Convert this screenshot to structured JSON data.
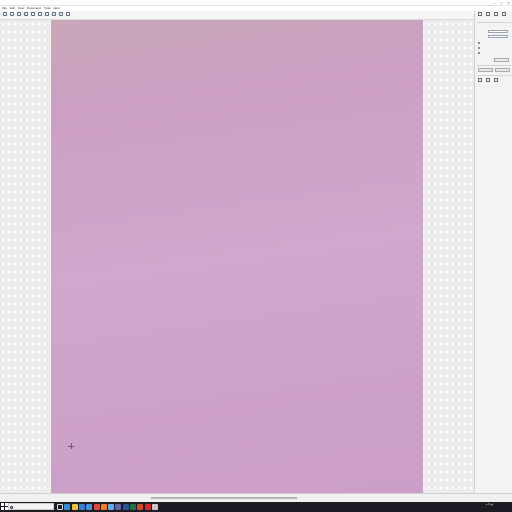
{
  "window": {
    "title": "",
    "controls": [
      "—",
      "□",
      "✕"
    ]
  },
  "menu": [
    "File",
    "Edit",
    "View",
    "Document",
    "Tools",
    "Help"
  ],
  "toolbar": [
    {
      "label": "",
      "icon": "open-icon"
    },
    {
      "label": "",
      "icon": "save-icon"
    },
    {
      "label": "",
      "icon": "print-icon"
    },
    {
      "label": "",
      "icon": "text-icon"
    },
    {
      "label": "",
      "icon": "edit-icon"
    },
    {
      "label": "",
      "icon": "image-icon"
    },
    {
      "label": "",
      "icon": "zoom-in-icon"
    },
    {
      "label": "",
      "icon": "zoom-out-icon"
    },
    {
      "label": "",
      "icon": "page-icon"
    },
    {
      "label": "",
      "icon": "settings-icon"
    },
    {
      "label": "",
      "icon": "help-icon"
    }
  ],
  "panel": {
    "tools": [
      {
        "label": "",
        "icon": "select-icon"
      },
      {
        "label": "",
        "icon": "draw-icon"
      },
      {
        "label": "",
        "icon": "crop-icon"
      },
      {
        "label": "",
        "icon": "fill-icon"
      }
    ],
    "fields": [
      {
        "label": "",
        "value": ""
      },
      {
        "label": "",
        "value": ""
      }
    ],
    "options": [
      {
        "label": ""
      },
      {
        "label": ""
      },
      {
        "label": ""
      },
      {
        "label": ""
      }
    ],
    "apply_label": "",
    "lower_buttons": [
      "",
      ""
    ],
    "bottom_tools": [
      {
        "label": "",
        "icon": "page-icon"
      },
      {
        "label": "",
        "icon": "copy-icon"
      },
      {
        "label": "",
        "icon": "layers-icon"
      }
    ]
  },
  "status": {
    "left": "",
    "mid1": "",
    "mid2": "",
    "right": ""
  },
  "taskbar": {
    "search_placeholder": "",
    "apps": [
      {
        "name": "task-view",
        "color": "#ffffff"
      },
      {
        "name": "edge",
        "color": "#2f8fd8"
      },
      {
        "name": "file-explorer",
        "color": "#f0c23a"
      },
      {
        "name": "store",
        "color": "#3a7bd5"
      },
      {
        "name": "mail",
        "color": "#4a90d9"
      },
      {
        "name": "chrome",
        "color": "#e94335"
      },
      {
        "name": "firefox",
        "color": "#ff7a1a"
      },
      {
        "name": "photos",
        "color": "#5fb0e8"
      },
      {
        "name": "teams",
        "color": "#6264a7"
      },
      {
        "name": "word",
        "color": "#2b5797"
      },
      {
        "name": "excel",
        "color": "#217346"
      },
      {
        "name": "powerpoint",
        "color": "#d24726"
      },
      {
        "name": "acrobat",
        "color": "#d62b2b"
      },
      {
        "name": "active-app",
        "color": "#c8c8c8"
      }
    ],
    "time": "",
    "date": ""
  }
}
